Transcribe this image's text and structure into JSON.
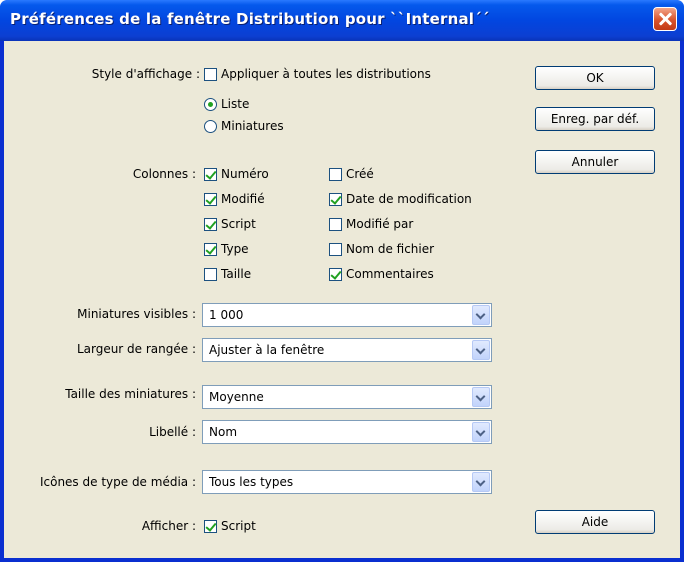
{
  "window": {
    "title": "Préférences de la fenêtre Distribution pour ``Internal´´"
  },
  "display_style": {
    "label": "Style d'affichage :",
    "apply_all": {
      "label": "Appliquer à toutes les distributions",
      "checked": false
    },
    "options": [
      {
        "label": "Liste",
        "selected": true
      },
      {
        "label": "Miniatures",
        "selected": false
      }
    ]
  },
  "columns": {
    "label": "Colonnes :",
    "left": [
      {
        "label": "Numéro",
        "checked": true
      },
      {
        "label": "Modifié",
        "checked": true
      },
      {
        "label": "Script",
        "checked": true
      },
      {
        "label": "Type",
        "checked": true
      },
      {
        "label": "Taille",
        "checked": false
      }
    ],
    "right": [
      {
        "label": "Créé",
        "checked": false
      },
      {
        "label": "Date de modification",
        "checked": true
      },
      {
        "label": "Modifié par",
        "checked": false
      },
      {
        "label": "Nom de fichier",
        "checked": false
      },
      {
        "label": "Commentaires",
        "checked": true
      }
    ]
  },
  "fields": {
    "visible_thumbnails": {
      "label": "Miniatures visibles :",
      "value": "1 000"
    },
    "row_width": {
      "label": "Largeur de rangée :",
      "value": "Ajuster à la fenêtre"
    },
    "thumbnail_size": {
      "label": "Taille des miniatures :",
      "value": "Moyenne"
    },
    "caption": {
      "label": "Libellé :",
      "value": "Nom"
    },
    "media_icons": {
      "label": "Icônes de type de média :",
      "value": "Tous les types"
    }
  },
  "show": {
    "label": "Afficher :",
    "script": {
      "label": "Script",
      "checked": true
    }
  },
  "buttons": {
    "ok": "OK",
    "save_default": "Enreg. par déf.",
    "cancel": "Annuler",
    "help": "Aide"
  }
}
